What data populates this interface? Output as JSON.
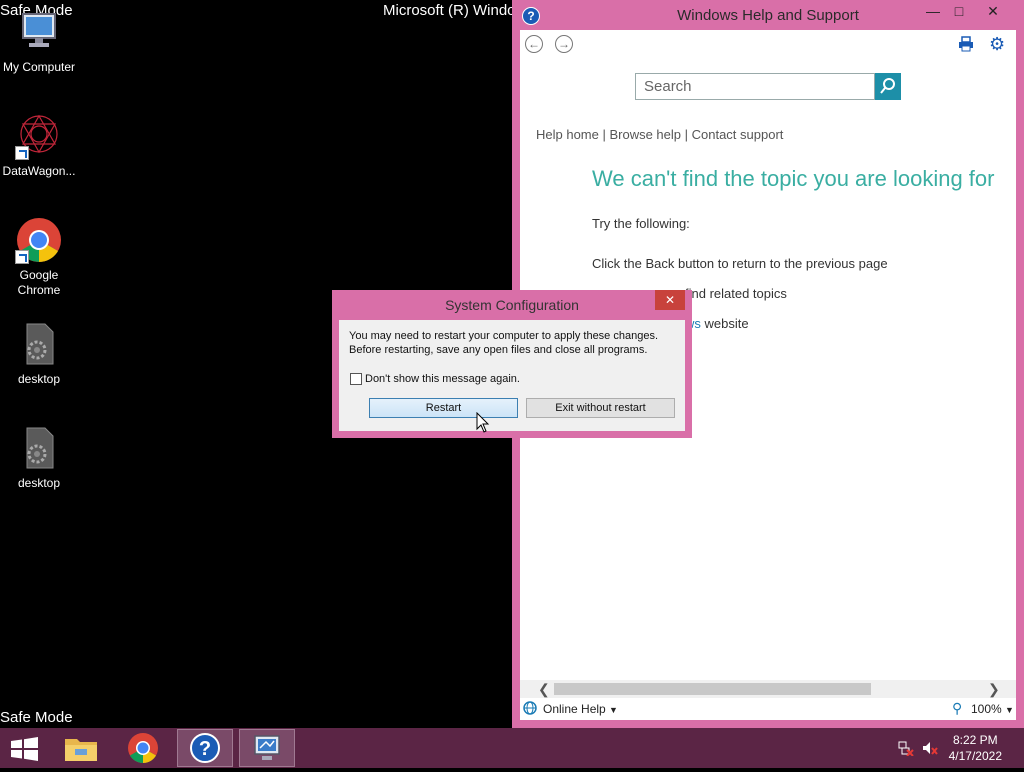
{
  "desktop": {
    "safe_mode_top": "Safe Mode",
    "safe_mode_bottom": "Safe Mode",
    "system_title": "Microsoft (R) Windo",
    "icons": [
      {
        "label": "My Computer",
        "icon": "computer-icon"
      },
      {
        "label": "DataWagon...",
        "icon": "datawagon-icon"
      },
      {
        "label": "Google\nChrome",
        "icon": "chrome-icon"
      },
      {
        "label": "desktop",
        "icon": "settings-file-icon"
      },
      {
        "label": "desktop",
        "icon": "settings-file-icon"
      }
    ]
  },
  "help_window": {
    "title": "Windows Help and Support",
    "search_placeholder": "Search",
    "breadcrumbs": "Help home | Browse help | Contact support",
    "heading": "We can't find the topic you are looking for",
    "try_following": "Try the following:",
    "line_back": "Click the Back button to return to the previous page",
    "line_find": "find related topics",
    "line_website_partial": "ws",
    "line_website": " website",
    "online_help": "Online Help",
    "zoom": "100%"
  },
  "dialog": {
    "title": "System Configuration",
    "message_line1": "You may need to restart your computer to apply these changes.",
    "message_line2": "Before restarting, save any open files and close all programs.",
    "checkbox_label": "Don't show this message again.",
    "checkbox_checked": false,
    "restart_label": "Restart",
    "exit_label": "Exit without restart"
  },
  "taskbar": {
    "time": "8:22 PM",
    "date": "4/17/2022",
    "items": [
      "start-icon",
      "file-explorer-icon",
      "chrome-icon",
      "help-icon",
      "system-config-icon"
    ]
  },
  "colors": {
    "window_frame": "#d96fa8",
    "taskbar": "#5b2545",
    "heading_teal": "#3aaea2",
    "search_button": "#1d8fa8"
  }
}
